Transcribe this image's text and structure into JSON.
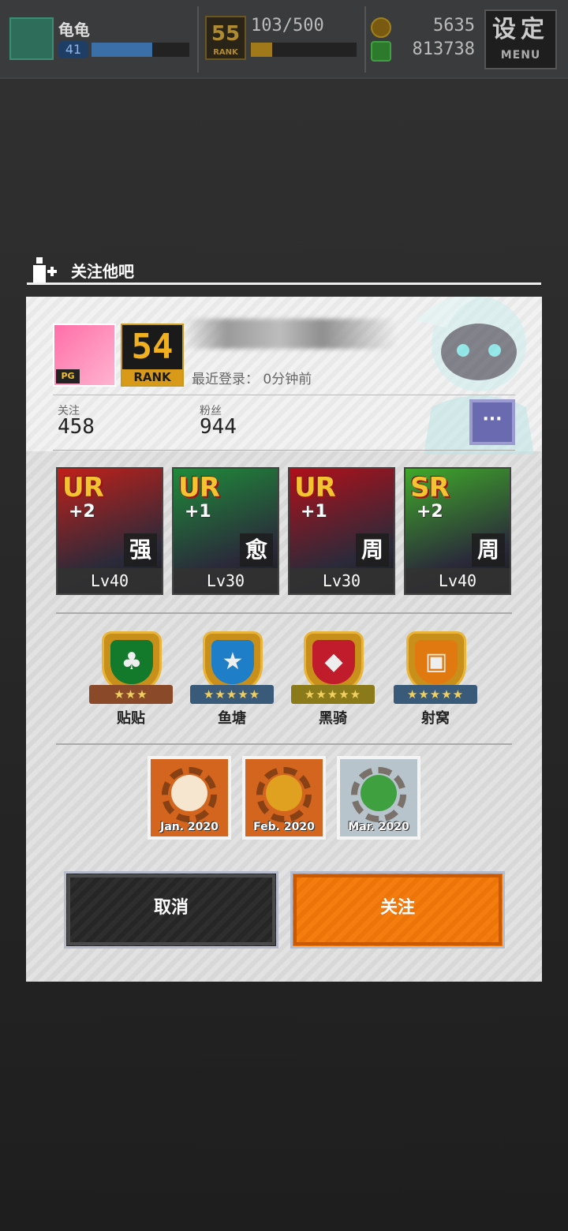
{
  "topbar": {
    "player_name": "龟龟",
    "level": "41",
    "exp_fraction": 0.62,
    "rank_number": "55",
    "rank_label": "RANK",
    "stamina": "103/500",
    "stamina_fraction": 0.2,
    "coins": "5635",
    "gems": "813738",
    "menu_cn": "设定",
    "menu_en": "MENU"
  },
  "dialog": {
    "title": "关注他吧",
    "user": {
      "badge": "PG",
      "rank_number": "54",
      "rank_label": "RANK",
      "last_login": "最近登录：  0分钟前"
    },
    "stats": {
      "following_label": "关注",
      "following_value": "458",
      "followers_label": "粉丝",
      "followers_value": "944"
    },
    "more_label": "···",
    "cards": [
      {
        "rarity": "UR",
        "plus": "+2",
        "attr": "强",
        "level": "Lv40",
        "color": "#c0201a"
      },
      {
        "rarity": "UR",
        "plus": "+1",
        "attr": "愈",
        "level": "Lv30",
        "color": "#1f8a3a"
      },
      {
        "rarity": "UR",
        "plus": "+1",
        "attr": "周",
        "level": "Lv30",
        "color": "#b0101a"
      },
      {
        "rarity": "SR",
        "plus": "+2",
        "attr": "周",
        "level": "Lv40",
        "color": "#3fa82a"
      }
    ],
    "clubs": [
      {
        "name": "贴贴",
        "stars": "★★★",
        "inner_color": "#127a2a",
        "ribbon_color": "#8a4a2a",
        "icon": "♣"
      },
      {
        "name": "鱼塘",
        "stars": "★★★★★",
        "inner_color": "#1e7ec8",
        "ribbon_color": "#3a5a7a",
        "icon": "★"
      },
      {
        "name": "黑骑",
        "stars": "★★★★★",
        "inner_color": "#c01c2c",
        "ribbon_color": "#8a7a1a",
        "icon": "◆"
      },
      {
        "name": "射窝",
        "stars": "★★★★★",
        "inner_color": "#e07a10",
        "ribbon_color": "#3a5a7a",
        "icon": "▣"
      }
    ],
    "monthly_badges": [
      {
        "date": "Jan. 2020",
        "bg": "#d4651e",
        "blob": "#f6e6d0"
      },
      {
        "date": "Feb. 2020",
        "bg": "#d4651e",
        "blob": "#e0a020"
      },
      {
        "date": "Mar. 2020",
        "bg": "#b8c4cc",
        "blob": "#3ea03e"
      }
    ],
    "cancel_label": "取消",
    "follow_label": "关注"
  }
}
